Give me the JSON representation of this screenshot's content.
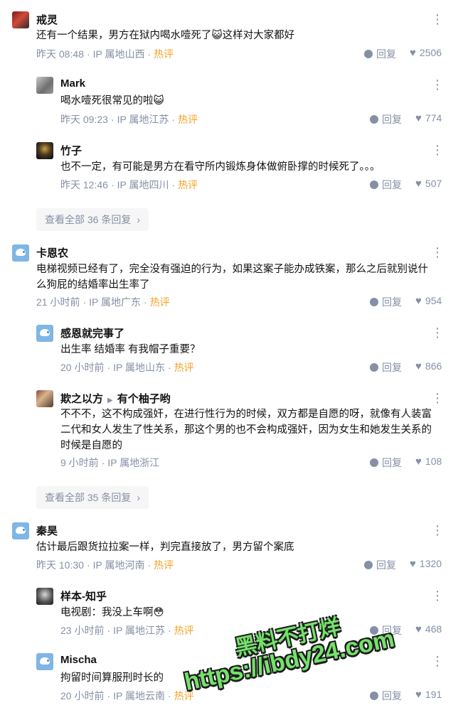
{
  "comments": [
    {
      "name": "戒灵",
      "text": "还有一个结果，男方在狱内喝水噎死了😺这样对大家都好",
      "time": "昨天 08:48",
      "ip": "IP 属地山西",
      "hot": "热评",
      "reply": "回复",
      "likes": "2506",
      "avatar": "red-dark-avatar"
    },
    {
      "name": "Mark",
      "text": "喝水噎死很常见的啦😺",
      "time": "昨天 09:23",
      "ip": "IP 属地江苏",
      "hot": "热评",
      "reply": "回复",
      "likes": "774",
      "avatar": "gray-avatar"
    },
    {
      "name": "竹子",
      "text": "也不一定，有可能是男方在看守所内锻炼身体做俯卧撑的时候死了。。。",
      "time": "昨天 12:46",
      "ip": "IP 属地四川",
      "hot": "热评",
      "reply": "回复",
      "likes": "507",
      "avatar": "bamboo-avatar"
    },
    {
      "name": "卡恩农",
      "text_line1": "电梯视频已经有了，完全没有强迫的行为，如果这案子能办成铁案，那么之后就别说什",
      "text_line2": "么狗屁的结婚率出生率了",
      "time": "21 小时前",
      "ip": "IP 属地广东",
      "hot": "热评",
      "reply": "回复",
      "likes": "954",
      "avatar": "default-avatar"
    },
    {
      "name": "感恩就完事了",
      "text": "出生率 结婚率 有我帽子重要？",
      "time": "20 小时前",
      "ip": "IP 属地山东",
      "hot": "热评",
      "reply": "回复",
      "likes": "866",
      "avatar": "default-avatar"
    },
    {
      "name": "欺之以方",
      "reply_to": "有个柚子哟",
      "text_line1": "不不不，这不构成强奸，在进行性行为的时候，双方都是自愿的呀，就像有人装富",
      "text_line2": "二代和女人发生了性关系，那这个男的也不会构成强奸，因为女生和她发生关系的",
      "text_line3": "时候是自愿的",
      "time": "9 小时前",
      "ip": "IP 属地浙江",
      "reply": "回复",
      "likes": "108",
      "avatar": "mixed-avatar"
    },
    {
      "name": "秦昊",
      "text": "估计最后跟货拉拉案一样，判完直接放了，男方留个案底",
      "time": "昨天 10:30",
      "ip": "IP 属地河南",
      "hot": "热评",
      "reply": "回复",
      "likes": "1320",
      "avatar": "default-avatar"
    },
    {
      "name": "样本-知乎",
      "text": "电视剧：我没上车啊😳",
      "time": "23 小时前",
      "ip": "IP 属地江苏",
      "hot": "热评",
      "reply": "回复",
      "likes": "468",
      "avatar": "bw-avatar"
    },
    {
      "name": "Mischa",
      "text": "拘留时间算服刑时长的",
      "time": "20 小时前",
      "ip": "IP 属地云南",
      "hot": "热评",
      "reply": "回复",
      "likes": "191",
      "avatar": "default-avatar"
    }
  ],
  "more_buttons": [
    {
      "label": "查看全部 36 条回复"
    },
    {
      "label": "查看全部 35 条回复"
    }
  ],
  "separator": "·",
  "watermark": {
    "line1": "黑料不打烊",
    "line2": "https://ibdy24.com"
  },
  "colors": {
    "meta": "#8590a6",
    "hot": "#f1a427",
    "watermark": "#74e26b"
  }
}
